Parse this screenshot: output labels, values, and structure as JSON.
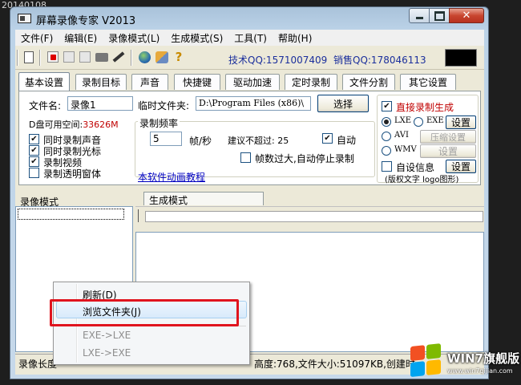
{
  "date_stamp": "20140108",
  "window": {
    "title": "屏幕录像专家 V2013"
  },
  "menu": [
    "文件(F)",
    "编辑(E)",
    "录像模式(L)",
    "生成模式(S)",
    "工具(T)",
    "帮助(H)"
  ],
  "toolbar": {
    "icons": [
      "new-doc-icon",
      "record-icon",
      "pause-icon",
      "stop-icon",
      "camera-icon",
      "pen-icon",
      "globe-icon",
      "tools-icon",
      "help-icon"
    ],
    "tech_qq": "技术QQ:1571007409",
    "sales_qq": "销售QQ:178046113"
  },
  "tabs": [
    "基本设置",
    "录制目标",
    "声音",
    "快捷键",
    "驱动加速",
    "定时录制",
    "文件分割",
    "其它设置"
  ],
  "basic": {
    "filename_label": "文件名:",
    "filename_value": "录像1",
    "tempdir_label": "临时文件夹:",
    "tempdir_value": "D:\\Program Files (x86)\\",
    "browse_button": "选择",
    "disk_space_label": "D盘可用空间:",
    "disk_space_value": "33626M",
    "options": [
      {
        "label": "同时录制声音",
        "checked": true
      },
      {
        "label": "同时录制光标",
        "checked": true
      },
      {
        "label": "录制视频",
        "checked": true
      },
      {
        "label": "录制透明窗体",
        "checked": false
      }
    ],
    "frequency_group": "录制频率",
    "fps_value": "5",
    "fps_unit": "帧/秒",
    "suggest_label": "建议不超过: 25",
    "auto_label": "自动",
    "auto_checked": true,
    "auto_stop_label": "帧数过大,自动停止录制",
    "auto_stop_checked": false,
    "tutorial_link": "本软件动画教程"
  },
  "direct": {
    "title": "直接录制生成",
    "title_checked": true,
    "formats": [
      {
        "label": "LXE",
        "checked": true
      },
      {
        "label": "EXE",
        "checked": false
      },
      {
        "label": "AVI",
        "checked": false
      },
      {
        "label": "WMV",
        "checked": false
      }
    ],
    "setting_button": "设置",
    "compress_button": "压缩设置",
    "setting_button_2": "设置",
    "self_info_label": "自设信息",
    "self_info_checked": false,
    "self_info_button": "设置",
    "copyright_note": "(版权文字 logo图形)"
  },
  "sections": {
    "record_mode": "录像模式",
    "generate_mode": "生成模式"
  },
  "status": {
    "left": "录像长度",
    "right": "高度:768,文件大小:51097KB,创建时"
  },
  "context_menu": {
    "items": [
      {
        "label": "刷新(D)",
        "enabled": true
      },
      {
        "label": "浏览文件夹(J)",
        "enabled": true
      },
      {
        "label": "EXE->LXE",
        "enabled": false
      },
      {
        "label": "LXE->EXE",
        "enabled": false
      }
    ]
  },
  "watermark": {
    "text": "WIN7旗舰版",
    "url": "www.win7qijian.com"
  },
  "colors": {
    "accent_red": "#c00000",
    "highlight_box": "#e0141e",
    "qq_blue": "#1b2f9c"
  }
}
